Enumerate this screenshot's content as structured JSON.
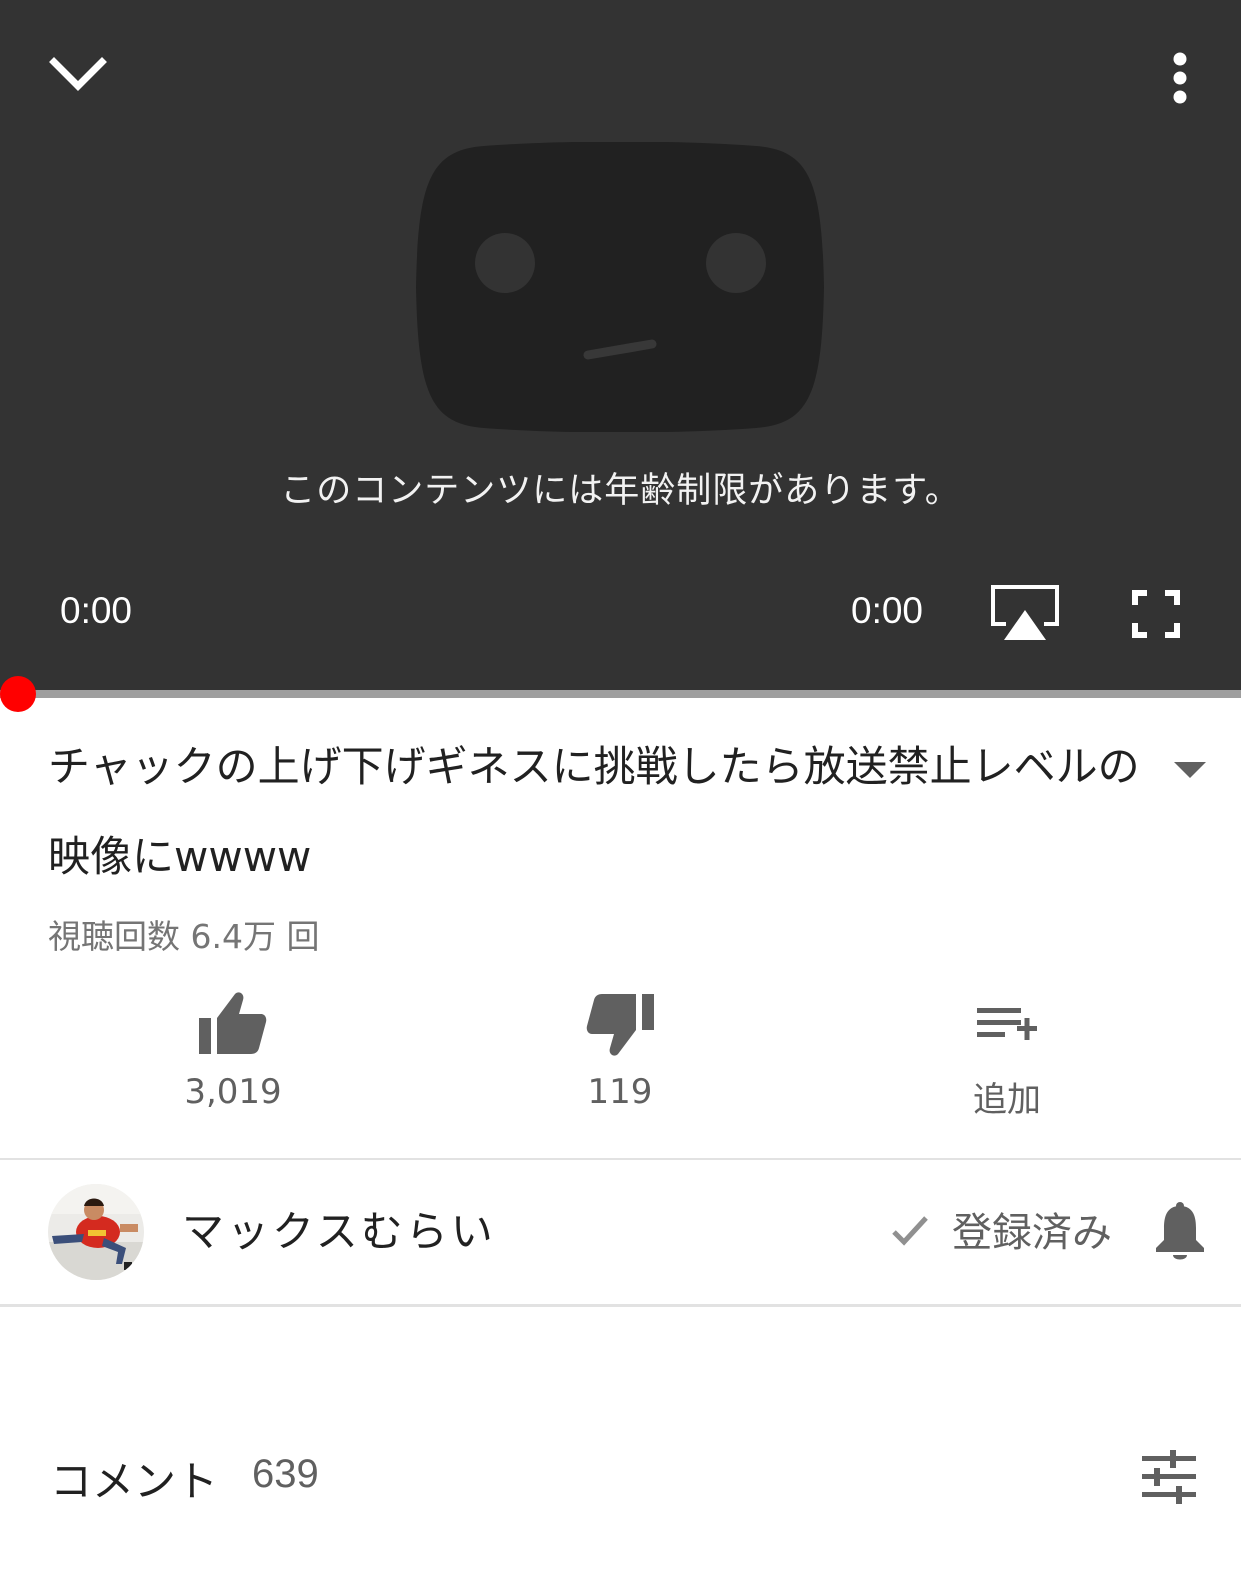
{
  "player": {
    "restriction_message": "このコンテンツには年齢制限があります。",
    "current_time": "0:00",
    "total_time": "0:00",
    "progress": 0,
    "accent_color": "#ff0000",
    "icons": {
      "collapse": "chevron-down-icon",
      "more": "more-vert-icon",
      "airplay": "airplay-icon",
      "fullscreen": "fullscreen-icon"
    }
  },
  "video": {
    "title": "チャックの上げ下げギネスに挑戦したら放送禁止レベルの映像にwwww",
    "view_count": "視聴回数 6.4万 回"
  },
  "actions": {
    "like_count": "3,019",
    "dislike_count": "119",
    "add_label": "追加"
  },
  "channel": {
    "name": "マックスむらい",
    "subscribed_label": "登録済み"
  },
  "comments": {
    "label": "コメント",
    "count": "639"
  }
}
